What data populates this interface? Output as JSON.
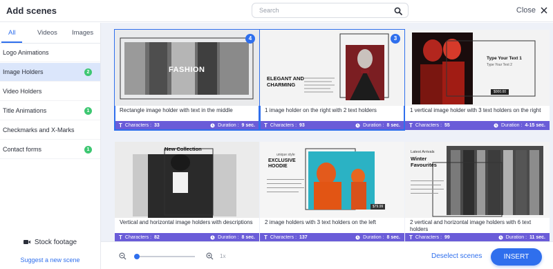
{
  "header": {
    "title": "Add scenes",
    "search_placeholder": "Search",
    "close_label": "Close"
  },
  "sidebar": {
    "tabs": [
      {
        "label": "All"
      },
      {
        "label": "Videos"
      },
      {
        "label": "Images"
      }
    ],
    "categories": [
      {
        "label": "Logo Animations",
        "count": ""
      },
      {
        "label": "Image Holders",
        "count": "2"
      },
      {
        "label": "Video Holders",
        "count": ""
      },
      {
        "label": "Title Animations",
        "count": "1"
      },
      {
        "label": "Checkmarks and X-Marks",
        "count": ""
      },
      {
        "label": "Contact forms",
        "count": "1"
      }
    ],
    "stock_label": "Stock footage",
    "suggest_label": "Suggest a new scene"
  },
  "cards": [
    {
      "caption": "Rectangle image holder with text in the middle",
      "characters_label": "Characters : ",
      "characters": "33",
      "duration_label": "Duration : ",
      "duration": "9 sec.",
      "badge": "4",
      "art_text": "FASHION"
    },
    {
      "caption": "1 image holder on the right with 2 text holders",
      "characters_label": "Characters : ",
      "characters": "93",
      "duration_label": "Duration : ",
      "duration": "8 sec.",
      "badge": "3",
      "art_text": "ELEGANT AND CHARMING"
    },
    {
      "caption": "1 vertical image holder with 3 text holders on the right",
      "characters_label": "Characters : ",
      "characters": "55",
      "duration_label": "Duration : ",
      "duration": "4-15 sec.",
      "art_text": "Type Your Text 1",
      "art_sub": "Type Your Text 2",
      "art_price": "$000.00"
    },
    {
      "caption": "Vertical and horizontal image holders with descriptions",
      "characters_label": "Characters : ",
      "characters": "82",
      "duration_label": "Duration : ",
      "duration": "8 sec.",
      "art_text": "New Collection"
    },
    {
      "caption": "2 image holders with 3 text holders on the left",
      "characters_label": "Characters : ",
      "characters": "137",
      "duration_label": "Duration : ",
      "duration": "8 sec.",
      "art_text": "EXCLUSIVE HOODIE",
      "art_sub": "unique style",
      "art_price": "$79.99"
    },
    {
      "caption": "2 vertical and horizontal image holders with 6 text holders",
      "characters_label": "Characters : ",
      "characters": "99",
      "duration_label": "Duration : ",
      "duration": "11 sec.",
      "art_sub": "Latest Arrivals",
      "art_text": "Winter Favourites"
    }
  ],
  "footer": {
    "zoom_value": 0.0,
    "zoom_level": "1x",
    "deselect_label": "Deselect scenes",
    "insert_label": "INSERT"
  },
  "colors": {
    "accent": "#2f6fed",
    "meta_bar": "#6a5cd8",
    "badge_green": "#3ec772",
    "selected_row": "#dbe6fb"
  }
}
